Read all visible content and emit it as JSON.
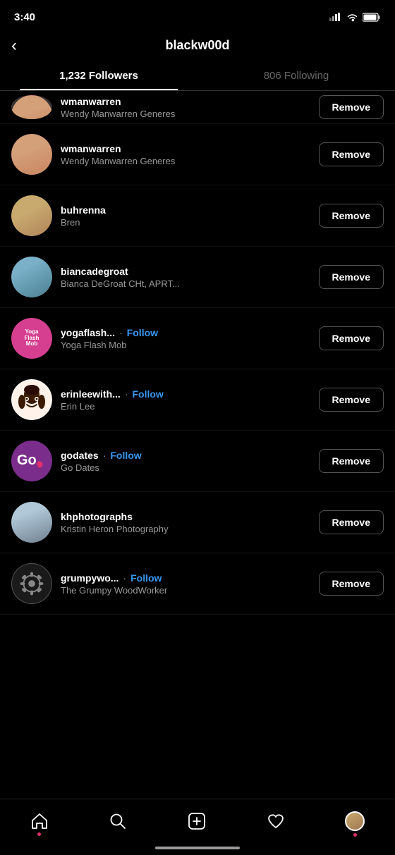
{
  "statusBar": {
    "time": "3:40",
    "signal": "signal-icon",
    "wifi": "wifi-icon",
    "battery": "battery-icon"
  },
  "header": {
    "back": "<",
    "title": "blackw00d",
    "backLabel": "back"
  },
  "tabs": [
    {
      "id": "followers",
      "label": "1,232 Followers",
      "active": true
    },
    {
      "id": "following",
      "label": "806 Following",
      "active": false
    }
  ],
  "followers": [
    {
      "id": 1,
      "username": "wmanwarren",
      "displayName": "Wendy Manwarren Generes",
      "followBack": false,
      "avatarStyle": "photo1",
      "hasRing": true,
      "partial": true
    },
    {
      "id": 2,
      "username": "wmanwarren",
      "displayName": "Wendy Manwarren Generes",
      "followBack": false,
      "avatarStyle": "photo1",
      "hasRing": true,
      "partial": false
    },
    {
      "id": 3,
      "username": "buhrenna",
      "displayName": "Bren",
      "followBack": false,
      "avatarStyle": "photo2",
      "hasRing": false,
      "partial": false
    },
    {
      "id": 4,
      "username": "biancadegroat",
      "displayName": "Bianca DeGroat CHt, APRT...",
      "followBack": false,
      "avatarStyle": "photo3",
      "hasRing": false,
      "partial": false
    },
    {
      "id": 5,
      "username": "yogaflash...",
      "displayName": "Yoga Flash Mob",
      "followBack": true,
      "followLabel": "Follow",
      "avatarStyle": "pink-logo",
      "hasRing": false,
      "partial": false
    },
    {
      "id": 6,
      "username": "erinleewith...",
      "displayName": "Erin Lee",
      "followBack": true,
      "followLabel": "Follow",
      "avatarStyle": "toon-white",
      "hasRing": false,
      "partial": false
    },
    {
      "id": 7,
      "username": "godates",
      "displayName": "Go Dates",
      "followBack": true,
      "followLabel": "Follow",
      "avatarStyle": "go-purple",
      "hasRing": false,
      "partial": false
    },
    {
      "id": 8,
      "username": "khphotographs",
      "displayName": "Kristin Heron Photography",
      "followBack": false,
      "avatarStyle": "photo5",
      "hasRing": false,
      "partial": false
    },
    {
      "id": 9,
      "username": "grumpywo...",
      "displayName": "The Grumpy WoodWorker",
      "followBack": true,
      "followLabel": "Follow",
      "avatarStyle": "dark-gear",
      "hasRing": false,
      "partial": false
    }
  ],
  "buttons": {
    "remove": "Remove",
    "follow": "Follow"
  },
  "bottomNav": {
    "items": [
      "home",
      "search",
      "add",
      "heart",
      "profile"
    ]
  }
}
